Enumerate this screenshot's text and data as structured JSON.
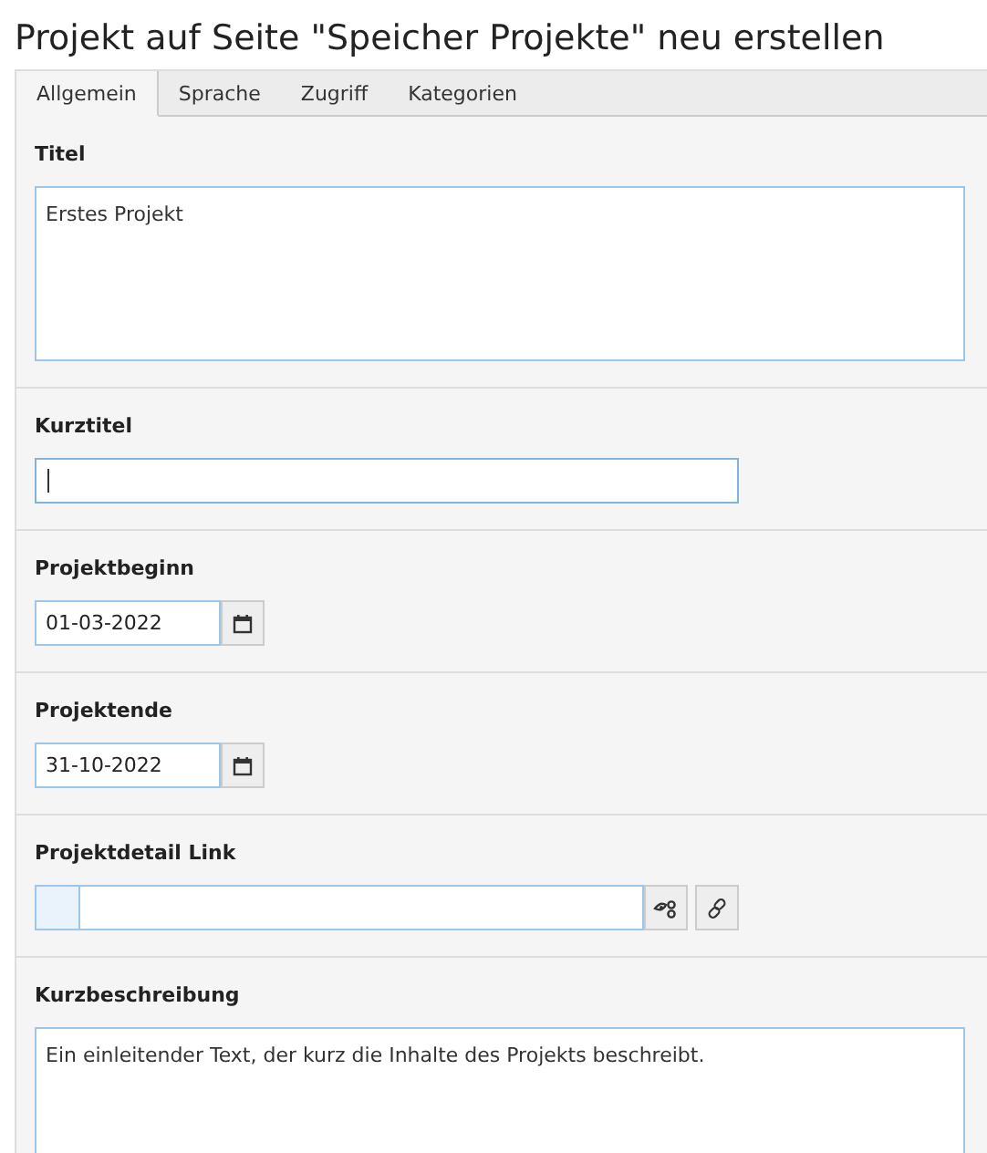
{
  "heading": "Projekt auf Seite \"Speicher Projekte\" neu erstellen",
  "tabs": [
    {
      "label": "Allgemein",
      "selected": true
    },
    {
      "label": "Sprache",
      "selected": false
    },
    {
      "label": "Zugriff",
      "selected": false
    },
    {
      "label": "Kategorien",
      "selected": false
    }
  ],
  "fields": [
    {
      "kind": "textarea",
      "label": "Titel",
      "value": "Erstes Projekt"
    },
    {
      "kind": "text",
      "label": "Kurztitel",
      "focused": true
    },
    {
      "kind": "date",
      "label": "Projektbeginn",
      "value": "01-03-2022"
    },
    {
      "kind": "date",
      "label": "Projektende",
      "value": "31-10-2022"
    },
    {
      "kind": "link",
      "label": "Projektdetail Link"
    },
    {
      "kind": "textarea-cut",
      "label": "Kurzbeschreibung",
      "value": "Ein einleitender Text, der kurz die Inhalte des Projekts beschreibt."
    }
  ]
}
